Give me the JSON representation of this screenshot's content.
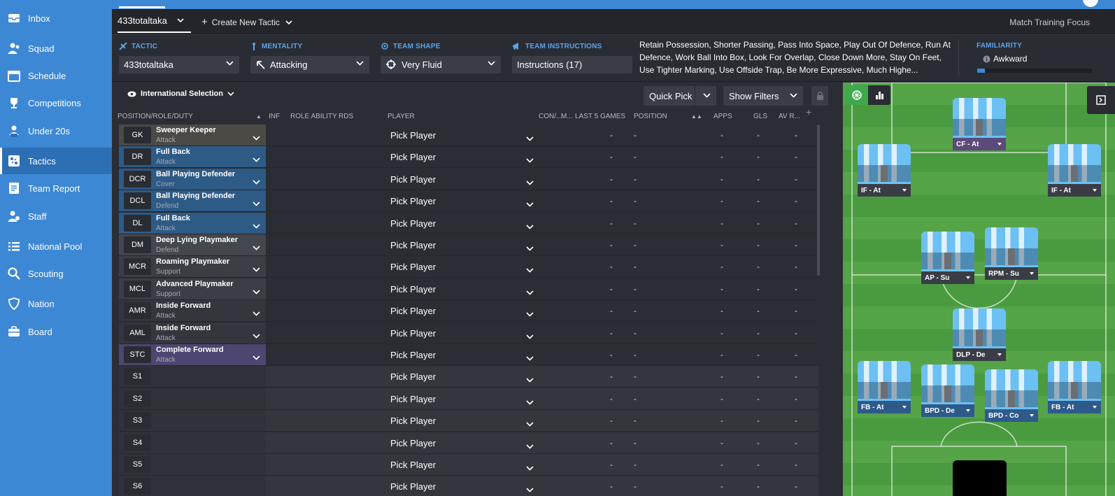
{
  "sidebar": {
    "items": [
      {
        "label": "Inbox",
        "icon": "inbox-icon"
      },
      {
        "label": "Squad",
        "icon": "squad-icon"
      },
      {
        "label": "Schedule",
        "icon": "calendar-icon"
      },
      {
        "label": "Competitions",
        "icon": "trophy-icon"
      },
      {
        "label": "Under 20s",
        "icon": "u20-icon"
      },
      {
        "label": "Tactics",
        "icon": "tactics-icon",
        "active": true
      },
      {
        "label": "Team Report",
        "icon": "report-icon"
      },
      {
        "label": "Staff",
        "icon": "staff-icon"
      },
      {
        "label": "National Pool",
        "icon": "list-icon"
      },
      {
        "label": "Scouting",
        "icon": "search-icon"
      },
      {
        "label": "Nation",
        "icon": "shield-icon"
      },
      {
        "label": "Board",
        "icon": "briefcase-icon"
      }
    ]
  },
  "tabs": {
    "current": "433totaltaka",
    "create": "Create New Tactic",
    "right": "Match Training Focus"
  },
  "controls": {
    "tactic_label": "TACTIC",
    "tactic_value": "433totaltaka",
    "mentality_label": "MENTALITY",
    "mentality_value": "Attacking",
    "shape_label": "TEAM SHAPE",
    "shape_value": "Very Fluid",
    "instructions_label": "TEAM INSTRUCTIONS",
    "instructions_value": "Instructions (17)",
    "instructions_text": "Retain Possession, Shorter Passing, Pass Into Space, Play Out Of Defence, Run At Defence, Work Ball Into Box, Look For Overlap, Close Down More, Stay On Feet, Use Tighter Marking, Use Offside Trap, Be More Expressive, Much Highe...",
    "familiarity_label": "FAMILIARITY",
    "familiarity_value": "Awkward",
    "familiarity_level": 0.07
  },
  "panel": {
    "selection": "International Selection",
    "quick_pick": "Quick Pick",
    "show_filters": "Show Filters",
    "columns": {
      "position": "POSITION/ROLE/DUTY",
      "inf": "INF",
      "role_ability": "ROLE ABILITY",
      "rds": "RDS",
      "player": "PLAYER",
      "con": "CON/...",
      "m": "M...",
      "last5": "LAST 5 GAMES",
      "position2": "POSITION",
      "apps": "APPS",
      "gls": "GLS",
      "avr": "AV R..."
    },
    "rows": [
      {
        "pos": "GK",
        "role": "Sweeper Keeper",
        "duty": "Attack",
        "color": "#4b4a45",
        "player": "Pick Player",
        "con": "-",
        "last5": "-",
        "apps": "-",
        "gls": "-",
        "avr": "-"
      },
      {
        "pos": "DR",
        "role": "Full Back",
        "duty": "Attack",
        "color": "#2e5a86",
        "player": "Pick Player",
        "con": "-",
        "last5": "-",
        "apps": "-",
        "gls": "-",
        "avr": "-"
      },
      {
        "pos": "DCR",
        "role": "Ball Playing Defender",
        "duty": "Cover",
        "color": "#2e5a86",
        "player": "Pick Player",
        "con": "-",
        "last5": "-",
        "apps": "-",
        "gls": "-",
        "avr": "-"
      },
      {
        "pos": "DCL",
        "role": "Ball Playing Defender",
        "duty": "Defend",
        "color": "#2e5a86",
        "player": "Pick Player",
        "con": "-",
        "last5": "-",
        "apps": "-",
        "gls": "-",
        "avr": "-"
      },
      {
        "pos": "DL",
        "role": "Full Back",
        "duty": "Attack",
        "color": "#2e5a86",
        "player": "Pick Player",
        "con": "-",
        "last5": "-",
        "apps": "-",
        "gls": "-",
        "avr": "-"
      },
      {
        "pos": "DM",
        "role": "Deep Lying Playmaker",
        "duty": "Defend",
        "color": "#44474e",
        "player": "Pick Player",
        "con": "-",
        "last5": "-",
        "apps": "-",
        "gls": "-",
        "avr": "-"
      },
      {
        "pos": "MCR",
        "role": "Roaming Playmaker",
        "duty": "Support",
        "color": "#3b3e45",
        "player": "Pick Player",
        "con": "-",
        "last5": "-",
        "apps": "-",
        "gls": "-",
        "avr": "-"
      },
      {
        "pos": "MCL",
        "role": "Advanced Playmaker",
        "duty": "Support",
        "color": "#3b3e45",
        "player": "Pick Player",
        "con": "-",
        "last5": "-",
        "apps": "-",
        "gls": "-",
        "avr": "-"
      },
      {
        "pos": "AMR",
        "role": "Inside Forward",
        "duty": "Attack",
        "color": "#34363d",
        "player": "Pick Player",
        "con": "-",
        "last5": "-",
        "apps": "-",
        "gls": "-",
        "avr": "-"
      },
      {
        "pos": "AML",
        "role": "Inside Forward",
        "duty": "Attack",
        "color": "#34363d",
        "player": "Pick Player",
        "con": "-",
        "last5": "-",
        "apps": "-",
        "gls": "-",
        "avr": "-"
      },
      {
        "pos": "STC",
        "role": "Complete Forward",
        "duty": "Attack",
        "color": "#4d4670",
        "player": "Pick Player",
        "con": "-",
        "last5": "-",
        "apps": "-",
        "gls": "-",
        "avr": "-"
      },
      {
        "pos": "S1",
        "role": "",
        "duty": "",
        "color": "",
        "player": "Pick Player",
        "con": "-",
        "last5": "-",
        "apps": "-",
        "gls": "-",
        "avr": "-"
      },
      {
        "pos": "S2",
        "role": "",
        "duty": "",
        "color": "",
        "player": "Pick Player",
        "con": "-",
        "last5": "-",
        "apps": "-",
        "gls": "-",
        "avr": "-"
      },
      {
        "pos": "S3",
        "role": "",
        "duty": "",
        "color": "",
        "player": "Pick Player",
        "con": "-",
        "last5": "-",
        "apps": "-",
        "gls": "-",
        "avr": "-"
      },
      {
        "pos": "S4",
        "role": "",
        "duty": "",
        "color": "",
        "player": "Pick Player",
        "con": "-",
        "last5": "-",
        "apps": "-",
        "gls": "-",
        "avr": "-"
      },
      {
        "pos": "S5",
        "role": "",
        "duty": "",
        "color": "",
        "player": "Pick Player",
        "con": "-",
        "last5": "-",
        "apps": "-",
        "gls": "-",
        "avr": "-"
      },
      {
        "pos": "S6",
        "role": "",
        "duty": "",
        "color": "",
        "player": "Pick Player",
        "con": "-",
        "last5": "-",
        "apps": "-",
        "gls": "-",
        "avr": "-"
      }
    ]
  },
  "pitch": {
    "cards": [
      {
        "label": "CF - At",
        "line": "att"
      },
      {
        "label": "IF - At",
        "line": "mid"
      },
      {
        "label": "IF - At",
        "line": "mid"
      },
      {
        "label": "AP - Su",
        "line": "mid"
      },
      {
        "label": "RPM - Su",
        "line": "mid"
      },
      {
        "label": "DLP - De",
        "line": "mid"
      },
      {
        "label": "FB - At",
        "line": "def"
      },
      {
        "label": "BPD - De",
        "line": "def"
      },
      {
        "label": "BPD - Co",
        "line": "def"
      },
      {
        "label": "FB - At",
        "line": "def"
      }
    ]
  }
}
